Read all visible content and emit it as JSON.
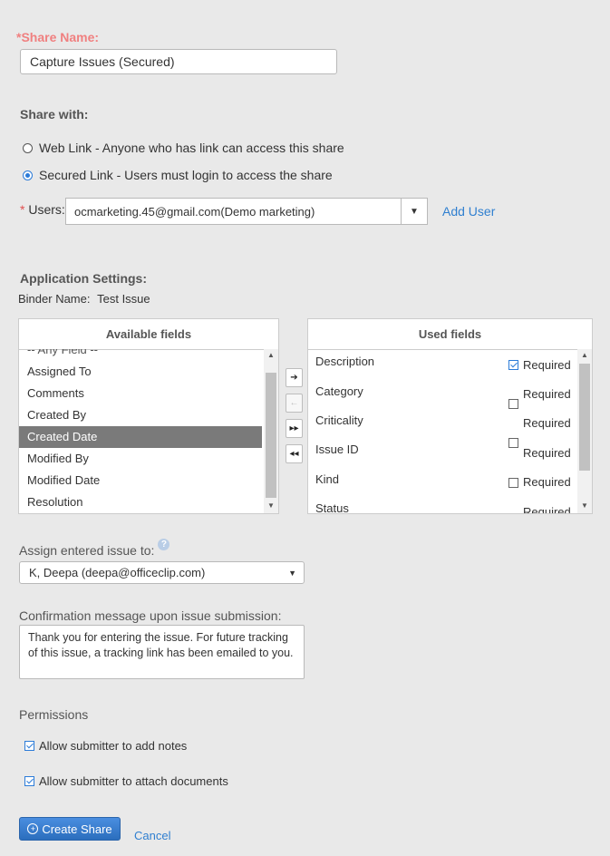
{
  "share_name": {
    "label": "*Share Name:",
    "value": "Capture Issues (Secured)"
  },
  "share_with": {
    "title": "Share with:",
    "options": [
      {
        "label": "Web Link - Anyone who has link can access this share",
        "selected": false
      },
      {
        "label": "Secured Link - Users must login to access the share",
        "selected": true
      }
    ]
  },
  "users": {
    "required_mark": "*",
    "label": "Users:",
    "value": "ocmarketing.45@gmail.com(Demo marketing)",
    "add_user_label": "Add User"
  },
  "app_settings": {
    "title": "Application Settings:",
    "binder_label": "Binder Name:",
    "binder_value": "Test Issue"
  },
  "available_fields": {
    "title": "Available fields",
    "items": [
      "-- Any Field --",
      "Assigned To",
      "Comments",
      "Created By",
      "Created Date",
      "Modified By",
      "Modified Date",
      "Resolution"
    ],
    "selected_item": "Created Date"
  },
  "move_buttons": {
    "add": "➔",
    "remove": "←",
    "add_all": "▸▸",
    "remove_all": "◂◂"
  },
  "used_fields": {
    "title": "Used fields",
    "required_label": "Required",
    "items": [
      {
        "name": "Description",
        "required": true
      },
      {
        "name": "Category",
        "required": false
      },
      {
        "name": "Criticality",
        "required": false
      },
      {
        "name": "Issue ID",
        "required": false
      },
      {
        "name": "Kind",
        "required": false
      },
      {
        "name": "Status",
        "required": false
      }
    ]
  },
  "assign": {
    "label": "Assign entered issue to:",
    "value": "K, Deepa (deepa@officeclip.com)"
  },
  "confirmation": {
    "label": "Confirmation message upon issue submission:",
    "value": "Thank you for entering the issue. For future tracking of this issue, a tracking link has been emailed to you."
  },
  "permissions": {
    "title": "Permissions",
    "items": [
      {
        "label": "Allow submitter to add notes",
        "checked": true
      },
      {
        "label": "Allow submitter to attach documents",
        "checked": true
      }
    ]
  },
  "actions": {
    "create_label": "Create Share",
    "cancel_label": "Cancel"
  },
  "colors": {
    "accent": "#2f7fd0",
    "required": "#f08080",
    "selected_row": "#7a7a7a"
  }
}
